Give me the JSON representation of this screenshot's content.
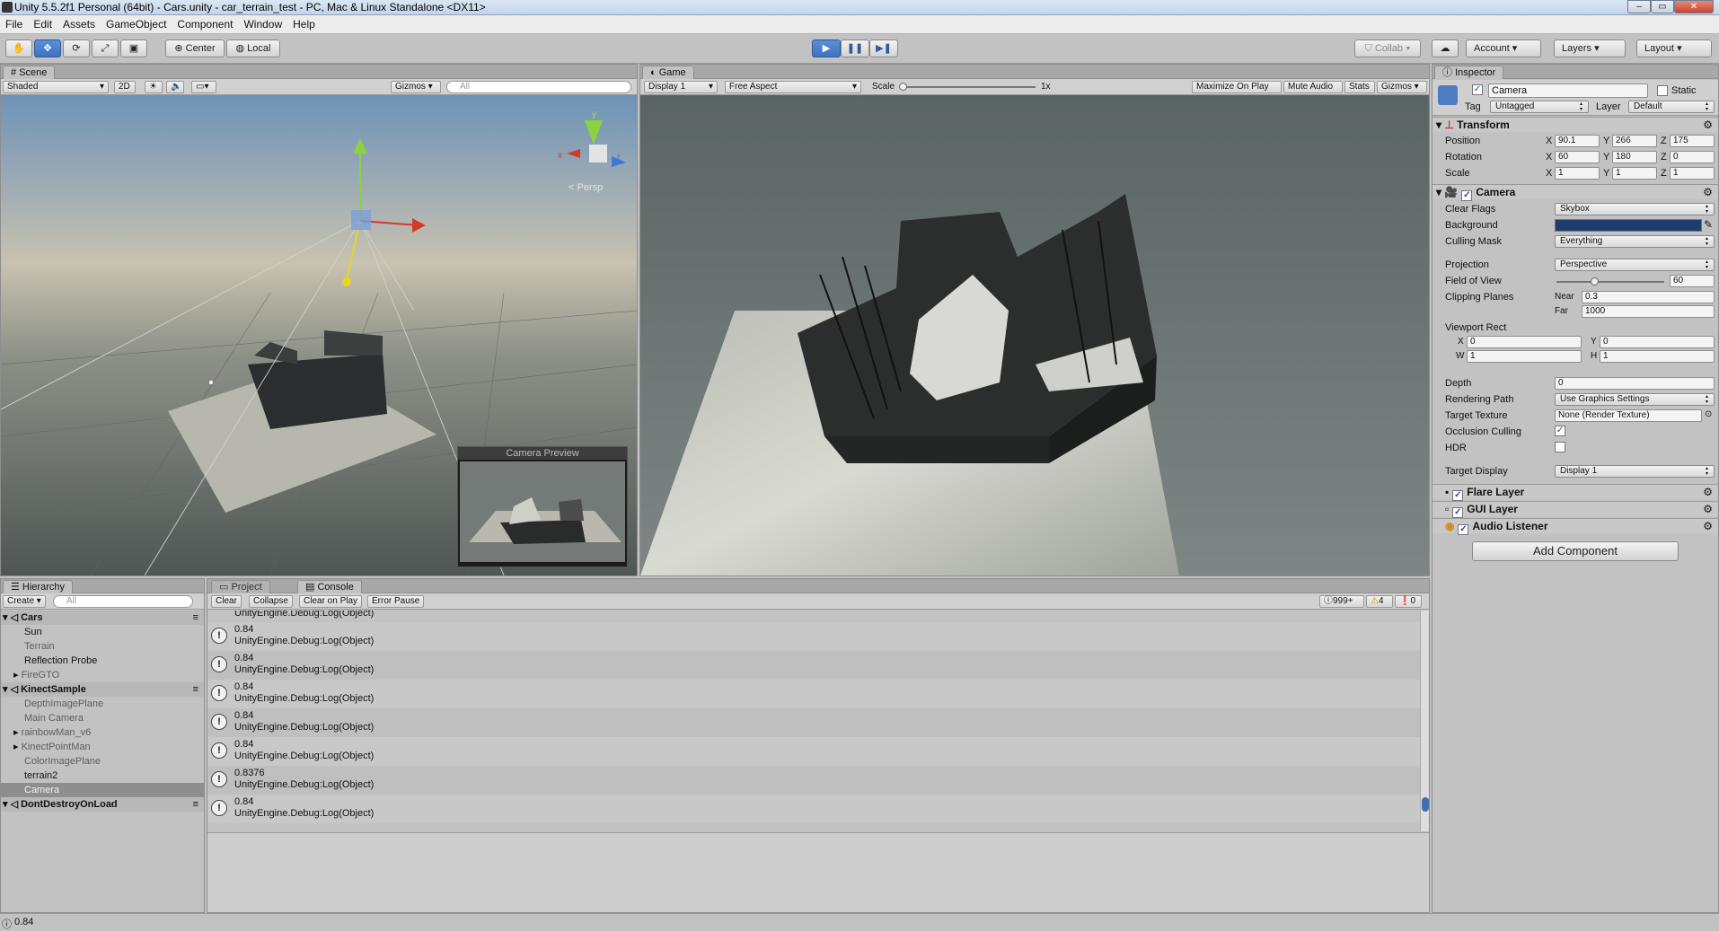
{
  "window": {
    "title": "Unity 5.5.2f1 Personal (64bit) - Cars.unity - car_terrain_test - PC, Mac & Linux Standalone <DX11>",
    "min": "–",
    "max": "▭",
    "close": "✕"
  },
  "menu": [
    "File",
    "Edit",
    "Assets",
    "GameObject",
    "Component",
    "Window",
    "Help"
  ],
  "toolbar": {
    "center": "Center",
    "local": "Local",
    "collab": "Collab",
    "account": "Account",
    "layers": "Layers",
    "layout": "Layout",
    "play": "▶",
    "pause": "❚❚",
    "step": "▶❚"
  },
  "scene": {
    "tab": "Scene",
    "shading": "Shaded",
    "mode2d": "2D",
    "gizmos": "Gizmos",
    "search": "All",
    "persp": "< Persp",
    "preview_title": "Camera Preview",
    "axis_x": "x",
    "axis_y": "y",
    "axis_z": "z"
  },
  "game": {
    "tab": "Game",
    "display": "Display 1",
    "aspect": "Free Aspect",
    "scale": "Scale",
    "scale_val": "1x",
    "maximize": "Maximize On Play",
    "mute": "Mute Audio",
    "stats": "Stats",
    "gizmos": "Gizmos"
  },
  "hierarchy": {
    "tab": "Hierarchy",
    "create": "Create",
    "search": "All",
    "items": [
      {
        "label": "Cars",
        "kind": "scene"
      },
      {
        "label": "Sun",
        "kind": "obj"
      },
      {
        "label": "Terrain",
        "kind": "dim"
      },
      {
        "label": "Reflection Probe",
        "kind": "obj"
      },
      {
        "label": "FireGTO",
        "kind": "dimfold"
      },
      {
        "label": "KinectSample",
        "kind": "scene"
      },
      {
        "label": "DepthImagePlane",
        "kind": "dim"
      },
      {
        "label": "Main Camera",
        "kind": "dim"
      },
      {
        "label": "rainbowMan_v6",
        "kind": "dimfold"
      },
      {
        "label": "KinectPointMan",
        "kind": "dimfold"
      },
      {
        "label": "ColorImagePlane",
        "kind": "dim"
      },
      {
        "label": "terrain2",
        "kind": "obj"
      },
      {
        "label": "Camera",
        "kind": "selected"
      },
      {
        "label": "DontDestroyOnLoad",
        "kind": "scene"
      }
    ]
  },
  "console": {
    "project_tab": "Project",
    "tab": "Console",
    "clear": "Clear",
    "collapse": "Collapse",
    "clear_on_play": "Clear on Play",
    "error_pause": "Error Pause",
    "log_count": "999+",
    "warn_count": "4",
    "err_count": "0",
    "top_partial": "UnityEngine.Debug:Log(Object)",
    "entries": [
      {
        "value": "0.84",
        "trace": "UnityEngine.Debug:Log(Object)"
      },
      {
        "value": "0.84",
        "trace": "UnityEngine.Debug:Log(Object)"
      },
      {
        "value": "0.84",
        "trace": "UnityEngine.Debug:Log(Object)"
      },
      {
        "value": "0.84",
        "trace": "UnityEngine.Debug:Log(Object)"
      },
      {
        "value": "0.84",
        "trace": "UnityEngine.Debug:Log(Object)"
      },
      {
        "value": "0.8376",
        "trace": "UnityEngine.Debug:Log(Object)"
      },
      {
        "value": "0.84",
        "trace": "UnityEngine.Debug:Log(Object)"
      }
    ]
  },
  "status": {
    "text": "0.84"
  },
  "inspector": {
    "tab": "Inspector",
    "object_name": "Camera",
    "static": "Static",
    "tag_label": "Tag",
    "tag": "Untagged",
    "layer_label": "Layer",
    "layer": "Default",
    "transform": {
      "title": "Transform",
      "position": "Position",
      "rotation": "Rotation",
      "scale": "Scale",
      "px": "90.1",
      "py": "266",
      "pz": "175",
      "rx": "60",
      "ry": "180",
      "rz": "0",
      "sx": "1",
      "sy": "1",
      "sz": "1",
      "X": "X",
      "Y": "Y",
      "Z": "Z"
    },
    "camera": {
      "title": "Camera",
      "clear_flags_label": "Clear Flags",
      "clear_flags": "Skybox",
      "background_label": "Background",
      "culling_mask_label": "Culling Mask",
      "culling_mask": "Everything",
      "projection_label": "Projection",
      "projection": "Perspective",
      "fov_label": "Field of View",
      "fov": "60",
      "clipping_label": "Clipping Planes",
      "near_label": "Near",
      "near": "0.3",
      "far_label": "Far",
      "far": "1000",
      "viewport_label": "Viewport Rect",
      "vx": "0",
      "vy": "0",
      "vw": "1",
      "vh": "1",
      "W": "W",
      "H": "H",
      "depth_label": "Depth",
      "depth": "0",
      "rendering_path_label": "Rendering Path",
      "rendering_path": "Use Graphics Settings",
      "target_texture_label": "Target Texture",
      "target_texture": "None (Render Texture)",
      "occlusion_label": "Occlusion Culling",
      "hdr_label": "HDR",
      "target_display_label": "Target Display",
      "target_display": "Display 1"
    },
    "components": [
      "Flare Layer",
      "GUI Layer",
      "Audio Listener"
    ],
    "add_component": "Add Component"
  },
  "colors": {
    "play_blue": "#3f73c1",
    "background_swatch": "#1f3c6e",
    "selected_row": "#8e8e8e"
  }
}
